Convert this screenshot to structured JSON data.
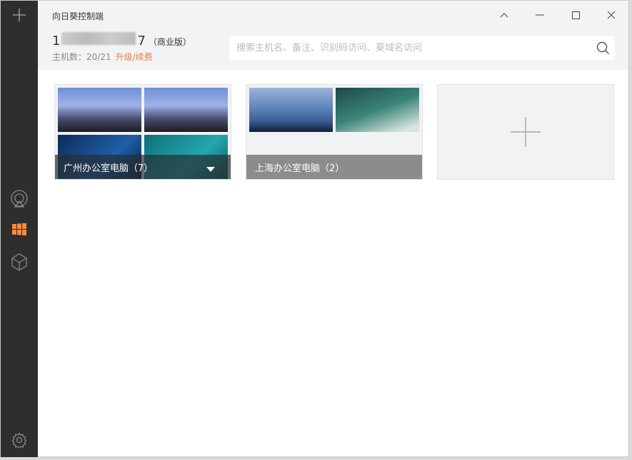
{
  "app": {
    "title": "向日葵控制端"
  },
  "account": {
    "id_start": "1",
    "id_end": "7",
    "edition": "（商业版）",
    "host_count_label": "主机数：20/21",
    "upgrade_link": "升级/续费"
  },
  "search": {
    "placeholder": "搜索主机名、备注、识别码访问、葵域名访问",
    "value": ""
  },
  "groups": [
    {
      "label": "广州办公室电脑（7）"
    },
    {
      "label": "上海办公室电脑（2）"
    }
  ],
  "colors": {
    "sidebar": "#2e2e2e",
    "accent": "#f07b3a",
    "header": "#f2f3f5"
  }
}
